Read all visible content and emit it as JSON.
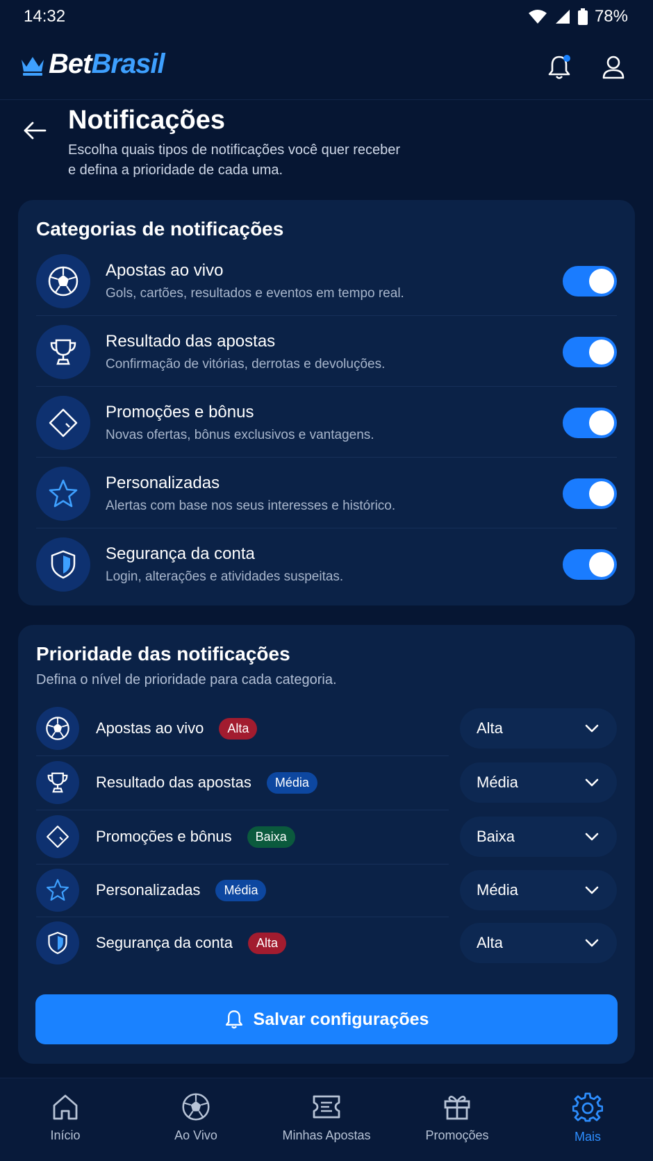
{
  "status": {
    "time": "14:32",
    "battery": "78%"
  },
  "brand": {
    "part1": "Bet",
    "part2": "Brasil",
    "accent": "#3ea0ff"
  },
  "page": {
    "title": "Notificações",
    "subtitle_line1": "Escolha quais tipos de notificações você quer receber",
    "subtitle_line2": "e defina a prioridade de cada uma."
  },
  "categories": {
    "title": "Categorias de notificações",
    "items": [
      {
        "icon": "soccer-ball-icon",
        "title": "Apostas ao vivo",
        "desc": "Gols, cartões, resultados e eventos em tempo real.",
        "enabled": true
      },
      {
        "icon": "trophy-icon",
        "title": "Resultado das apostas",
        "desc": "Confirmação de vitórias, derrotas e devoluções.",
        "enabled": true
      },
      {
        "icon": "ticket-icon",
        "title": "Promoções e bônus",
        "desc": "Novas ofertas, bônus exclusivos e vantagens.",
        "enabled": true
      },
      {
        "icon": "star-icon",
        "title": "Personalizadas",
        "desc": "Alertas com base nos seus interesses e histórico.",
        "enabled": true
      },
      {
        "icon": "shield-icon",
        "title": "Segurança da conta",
        "desc": "Login, alterações e atividades suspeitas.",
        "enabled": true
      }
    ]
  },
  "priority": {
    "title": "Prioridade das notificações",
    "subtitle": "Defina o nível de prioridade para cada categoria.",
    "items": [
      {
        "icon": "soccer-ball-icon",
        "title": "Apostas ao vivo",
        "badge": "Alta",
        "level": "alta",
        "selected": "Alta"
      },
      {
        "icon": "trophy-icon",
        "title": "Resultado das apostas",
        "badge": "Média",
        "level": "media",
        "selected": "Média"
      },
      {
        "icon": "ticket-icon",
        "title": "Promoções e bônus",
        "badge": "Baixa",
        "level": "baixa",
        "selected": "Baixa"
      },
      {
        "icon": "star-icon",
        "title": "Personalizadas",
        "badge": "Média",
        "level": "media",
        "selected": "Média"
      },
      {
        "icon": "shield-icon",
        "title": "Segurança da conta",
        "badge": "Alta",
        "level": "alta",
        "selected": "Alta"
      }
    ]
  },
  "save": {
    "label": "Salvar configurações"
  },
  "nav": {
    "items": [
      {
        "icon": "home-icon",
        "label": "Início",
        "active": false
      },
      {
        "icon": "soccer-ball-icon",
        "label": "Ao Vivo",
        "active": false
      },
      {
        "icon": "ticket-icon",
        "label": "Minhas Apostas",
        "active": false
      },
      {
        "icon": "gift-icon",
        "label": "Promoções",
        "active": false
      },
      {
        "icon": "gear-icon",
        "label": "Mais",
        "active": true
      }
    ]
  }
}
